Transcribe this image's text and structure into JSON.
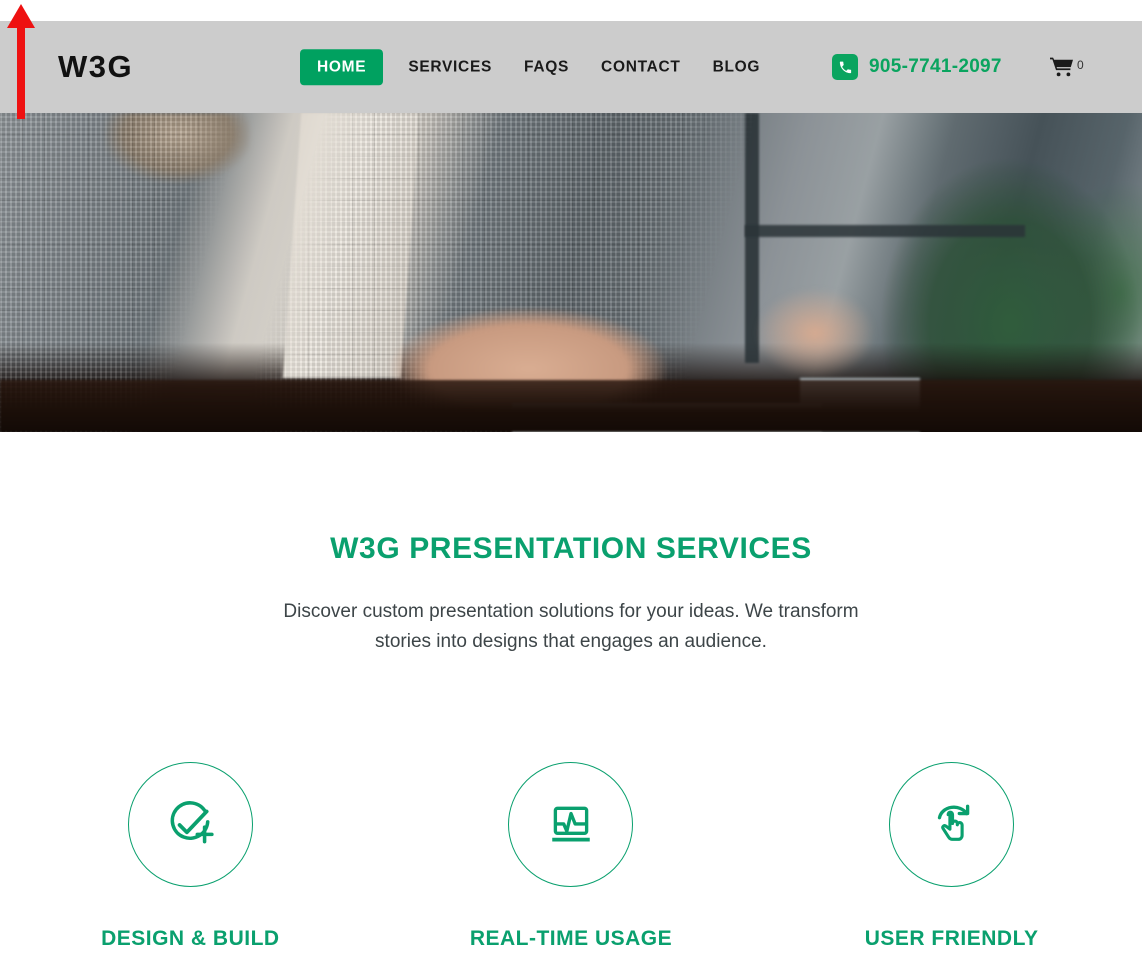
{
  "header": {
    "logo": "W3G",
    "nav": [
      {
        "label": "HOME",
        "active": true,
        "name": "nav-home"
      },
      {
        "label": "SERVICES",
        "active": false,
        "name": "nav-services"
      },
      {
        "label": "FAQS",
        "active": false,
        "name": "nav-faqs"
      },
      {
        "label": "CONTACT",
        "active": false,
        "name": "nav-contact"
      },
      {
        "label": "BLOG",
        "active": false,
        "name": "nav-blog"
      }
    ],
    "phone": "905-7741-2097",
    "phone_icon": "phone-icon",
    "cart_icon": "shopping-cart-icon",
    "cart_count": "0",
    "bg_color": "#cccccc"
  },
  "hero": {
    "alt": "Person in grey plaid blazer typing on a laptop at a desk beside a potted plant and window"
  },
  "main": {
    "title": "W3G PRESENTATION SERVICES",
    "subtitle": "Discover custom presentation solutions for your ideas. We transform stories into designs that engages an audience.",
    "features": [
      {
        "title": "DESIGN & BUILD",
        "icon": "circle-check-plus-icon"
      },
      {
        "title": "REAL-TIME USAGE",
        "icon": "monitor-pulse-chart-icon"
      },
      {
        "title": "USER FRIENDLY",
        "icon": "hand-pointer-refresh-icon"
      }
    ]
  },
  "annotation": {
    "arrow": "scroll-up-arrow",
    "color": "#ee1111"
  },
  "colors": {
    "brand_green": "#00a160",
    "heading_green": "#0aa06e",
    "phone_green": "#0aa45f",
    "header_grey": "#cccccc",
    "text_dark": "#1a1a1a"
  }
}
